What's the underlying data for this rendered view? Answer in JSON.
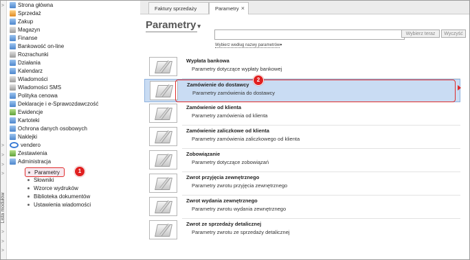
{
  "sidebar_strip": {
    "label": "Lista modułów",
    "chevrons": [
      ">",
      ">",
      ">",
      ">",
      ">",
      ">",
      ">",
      ">"
    ]
  },
  "nav": {
    "items": [
      {
        "label": "Strona główna",
        "icon": "home-icon"
      },
      {
        "label": "Sprzedaż",
        "icon": "sales-icon"
      },
      {
        "label": "Zakup",
        "icon": "purchase-icon"
      },
      {
        "label": "Magazyn",
        "icon": "warehouse-icon"
      },
      {
        "label": "Finanse",
        "icon": "finance-icon"
      },
      {
        "label": "Bankowość on-line",
        "icon": "bank-icon"
      },
      {
        "label": "Rozrachunki",
        "icon": "settlements-icon"
      },
      {
        "label": "Działania",
        "icon": "activities-icon"
      },
      {
        "label": "Kalendarz",
        "icon": "calendar-icon"
      },
      {
        "label": "Wiadomości",
        "icon": "messages-icon"
      },
      {
        "label": "Wiadomości SMS",
        "icon": "sms-icon"
      },
      {
        "label": "Polityka cenowa",
        "icon": "price-policy-icon"
      },
      {
        "label": "Deklaracje i e-Sprawozdawczość",
        "icon": "declarations-icon"
      },
      {
        "label": "Ewidencje",
        "icon": "records-icon"
      },
      {
        "label": "Kartoteki",
        "icon": "index-cards-icon"
      },
      {
        "label": "Ochrona danych osobowych",
        "icon": "data-protection-icon"
      },
      {
        "label": "Naklejki",
        "icon": "stickers-icon"
      },
      {
        "label": "vendero",
        "icon": "vendero-icon"
      },
      {
        "label": "Zestawienia",
        "icon": "reports-icon"
      },
      {
        "label": "Administracja",
        "icon": "admin-icon"
      }
    ],
    "admin_sub": [
      "Parametry",
      "Słowniki",
      "Wzorce wydruków",
      "Biblioteka dokumentów",
      "Ustawienia wiadomości"
    ]
  },
  "badges": {
    "one": "1",
    "two": "2"
  },
  "tabs": [
    {
      "label": "Faktury sprzedaży",
      "close": "×"
    },
    {
      "label": "Parametry",
      "close": "×"
    }
  ],
  "main": {
    "title": "Parametry",
    "title_caret": "▾",
    "search_placeholder": "",
    "search_button": "Wybierz teraz",
    "clear_button": "Wyczyść",
    "filter_link": "Wybierz według nazwy parametrów",
    "filter_caret": "▾"
  },
  "rows": [
    {
      "title": "Wypłata bankowa",
      "desc": "Parametry dotyczące wypłaty bankowej"
    },
    {
      "title": "Zamówienie do dostawcy",
      "desc": "Parametry zamówienia do dostawcy"
    },
    {
      "title": "Zamówienie od klienta",
      "desc": "Parametry zamówienia od klienta"
    },
    {
      "title": "Zamówienie zaliczkowe od klienta",
      "desc": "Parametry zamówienia zaliczkowego od klienta"
    },
    {
      "title": "Zobowiązanie",
      "desc": "Parametry dotyczące zobowiązań"
    },
    {
      "title": "Zwrot przyjęcia zewnętrznego",
      "desc": "Parametry zwrotu przyjęcia zewnętrznego"
    },
    {
      "title": "Zwrot wydania zewnętrznego",
      "desc": "Parametry zwrotu wydania zewnętrznego"
    },
    {
      "title": "Zwrot ze sprzedaży detalicznej",
      "desc": "Parametry zwrotu ze sprzedaży detalicznej"
    }
  ]
}
